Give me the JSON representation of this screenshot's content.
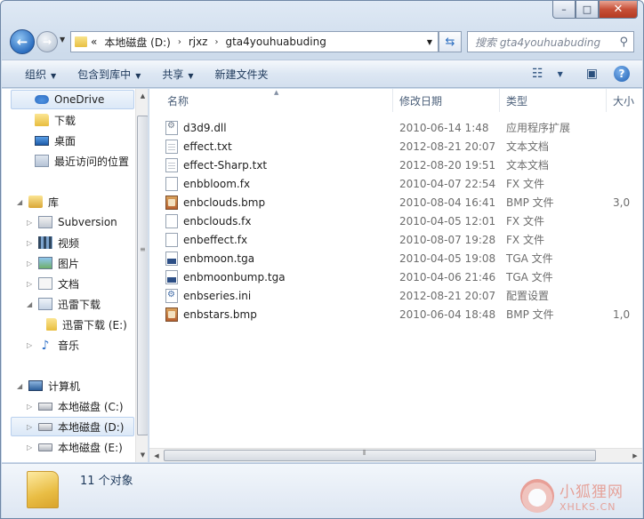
{
  "window": {
    "minimize_glyph": "–",
    "maximize_glyph": "□",
    "close_glyph": "✕"
  },
  "nav": {
    "back_glyph": "←",
    "forward_glyph": "→",
    "breadcrumb_prefix": "«",
    "breadcrumbs": [
      "本地磁盘 (D:)",
      "rjxz",
      "gta4youhuabuding"
    ],
    "search_placeholder": "搜索 gta4youhuabuding"
  },
  "toolbar": {
    "organize": "组织",
    "include_in_library": "包含到库中",
    "share": "共享",
    "new_folder": "新建文件夹"
  },
  "navpane": {
    "favorites": [
      {
        "label": "OneDrive",
        "icon": "onedrive-icon",
        "selected": true
      },
      {
        "label": "下载",
        "icon": "download-folder-icon"
      },
      {
        "label": "桌面",
        "icon": "desktop-icon"
      },
      {
        "label": "最近访问的位置",
        "icon": "recent-places-icon"
      }
    ],
    "library_label": "库",
    "libraries": [
      {
        "label": "Subversion",
        "icon": "svn-library-icon"
      },
      {
        "label": "视频",
        "icon": "videos-icon"
      },
      {
        "label": "图片",
        "icon": "pictures-icon"
      },
      {
        "label": "文档",
        "icon": "documents-icon"
      },
      {
        "label": "迅雷下载",
        "icon": "thunder-download-icon",
        "expanded": true
      },
      {
        "label": "迅雷下载 (E:)",
        "icon": "folder-icon",
        "child": true
      },
      {
        "label": "音乐",
        "icon": "music-icon"
      }
    ],
    "computer_label": "计算机",
    "drives": [
      {
        "label": "本地磁盘 (C:)",
        "icon": "system-drive-icon"
      },
      {
        "label": "本地磁盘 (D:)",
        "icon": "drive-icon",
        "selected": true
      },
      {
        "label": "本地磁盘 (E:)",
        "icon": "drive-icon"
      }
    ]
  },
  "columns": {
    "name": "名称",
    "date": "修改日期",
    "type": "类型",
    "size": "大小"
  },
  "files": [
    {
      "name": "d3d9.dll",
      "date": "2010-06-14 1:48",
      "type": "应用程序扩展",
      "size": "",
      "icon": "dll-file-icon"
    },
    {
      "name": "effect.txt",
      "date": "2012-08-21 20:07",
      "type": "文本文档",
      "size": "",
      "icon": "text-file-icon"
    },
    {
      "name": "effect-Sharp.txt",
      "date": "2012-08-20 19:51",
      "type": "文本文档",
      "size": "",
      "icon": "text-file-icon"
    },
    {
      "name": "enbbloom.fx",
      "date": "2010-04-07 22:54",
      "type": "FX 文件",
      "size": "",
      "icon": "fx-file-icon"
    },
    {
      "name": "enbclouds.bmp",
      "date": "2010-08-04 16:41",
      "type": "BMP 文件",
      "size": "3,0",
      "icon": "bmp-file-icon"
    },
    {
      "name": "enbclouds.fx",
      "date": "2010-04-05 12:01",
      "type": "FX 文件",
      "size": "",
      "icon": "fx-file-icon"
    },
    {
      "name": "enbeffect.fx",
      "date": "2010-08-07 19:28",
      "type": "FX 文件",
      "size": "",
      "icon": "fx-file-icon"
    },
    {
      "name": "enbmoon.tga",
      "date": "2010-04-05 19:08",
      "type": "TGA 文件",
      "size": "",
      "icon": "tga-file-icon"
    },
    {
      "name": "enbmoonbump.tga",
      "date": "2010-04-06 21:46",
      "type": "TGA 文件",
      "size": "",
      "icon": "tga-file-icon"
    },
    {
      "name": "enbseries.ini",
      "date": "2012-08-21 20:07",
      "type": "配置设置",
      "size": "",
      "icon": "ini-file-icon"
    },
    {
      "name": "enbstars.bmp",
      "date": "2010-06-04 18:48",
      "type": "BMP 文件",
      "size": "1,0",
      "icon": "bmp-file-icon"
    }
  ],
  "status": {
    "item_count": "11 个对象"
  },
  "watermark": {
    "line1": "小狐狸网",
    "line2": "XHLKS.CN"
  }
}
